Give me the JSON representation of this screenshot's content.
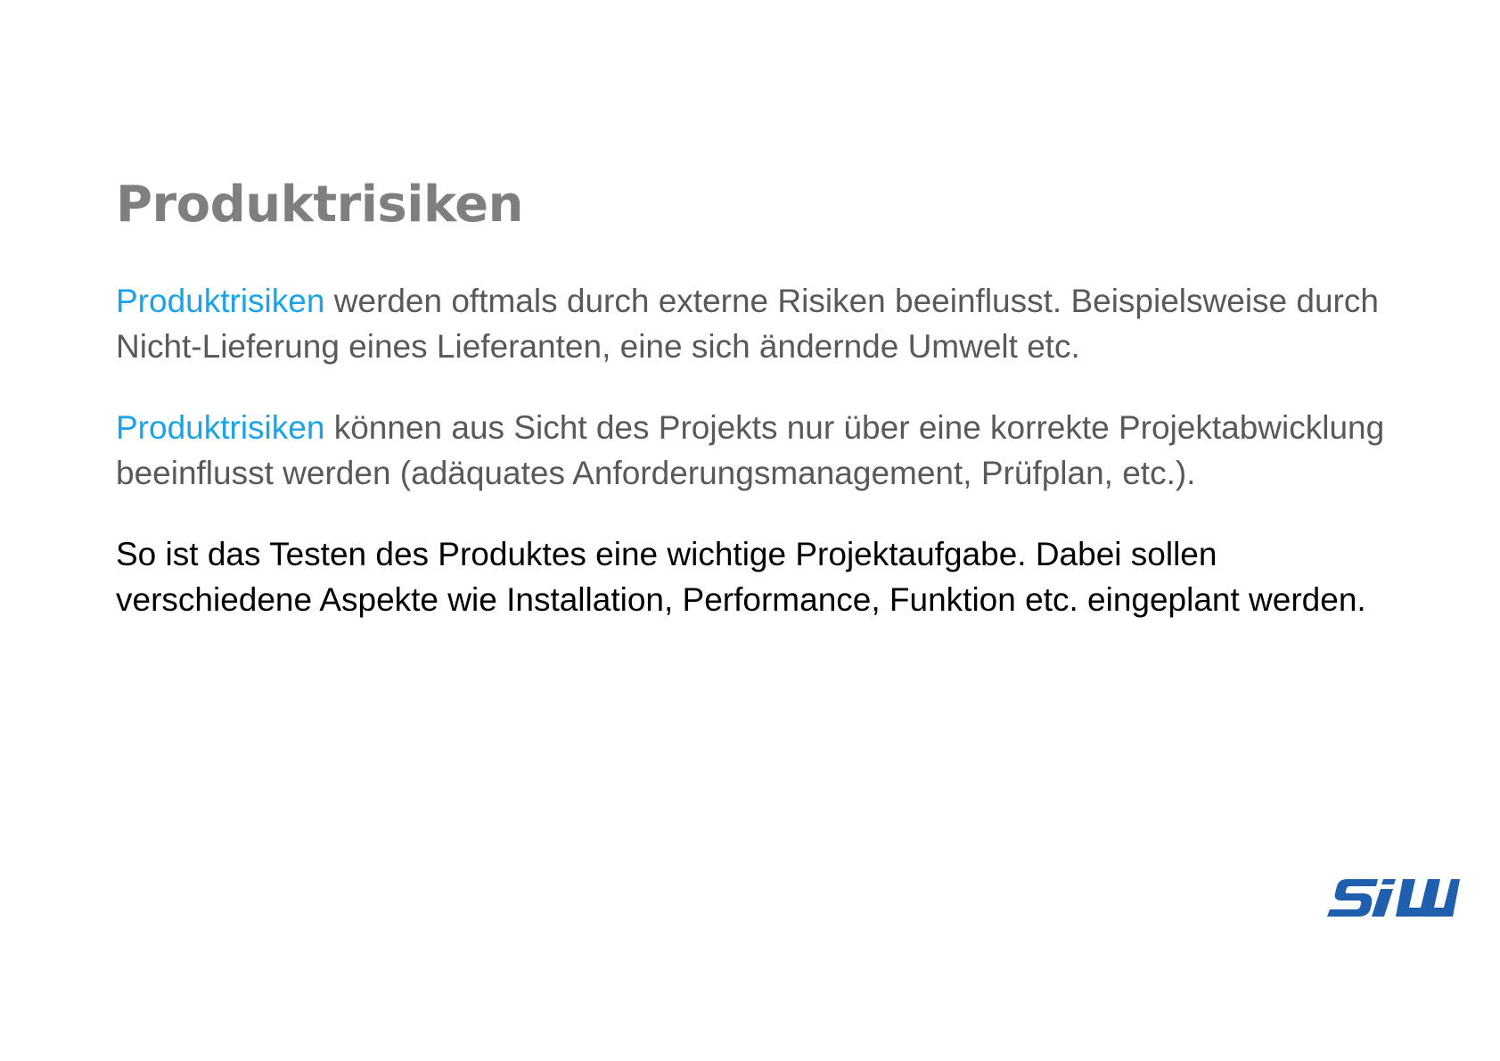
{
  "slide": {
    "title": "Produktrisiken",
    "paragraphs": [
      {
        "highlight": "Produktrisiken",
        "text": " werden oftmals durch externe Risiken beeinflusst. Beispielsweise durch Nicht-Lieferung eines Lieferanten, eine sich ändernde Umwelt etc."
      },
      {
        "highlight": "Produktrisiken",
        "text": " können aus Sicht des Projekts nur über eine korrekte Projektabwicklung beeinflusst werden (adäquates Anforderungsmanagement, Prüfplan, etc.)."
      },
      {
        "text": "So ist das Testen des Produktes eine wichtige Projektaufgabe. Dabei sollen verschiedene Aspekte wie Installation, Performance, Funktion etc. eingeplant werden."
      }
    ],
    "logo": {
      "text": "SiW",
      "color": "#1f5fae"
    },
    "colors": {
      "title": "#7f7f7f",
      "body": "#595959",
      "highlight": "#1aa3e8",
      "emphasis": "#000000"
    }
  }
}
